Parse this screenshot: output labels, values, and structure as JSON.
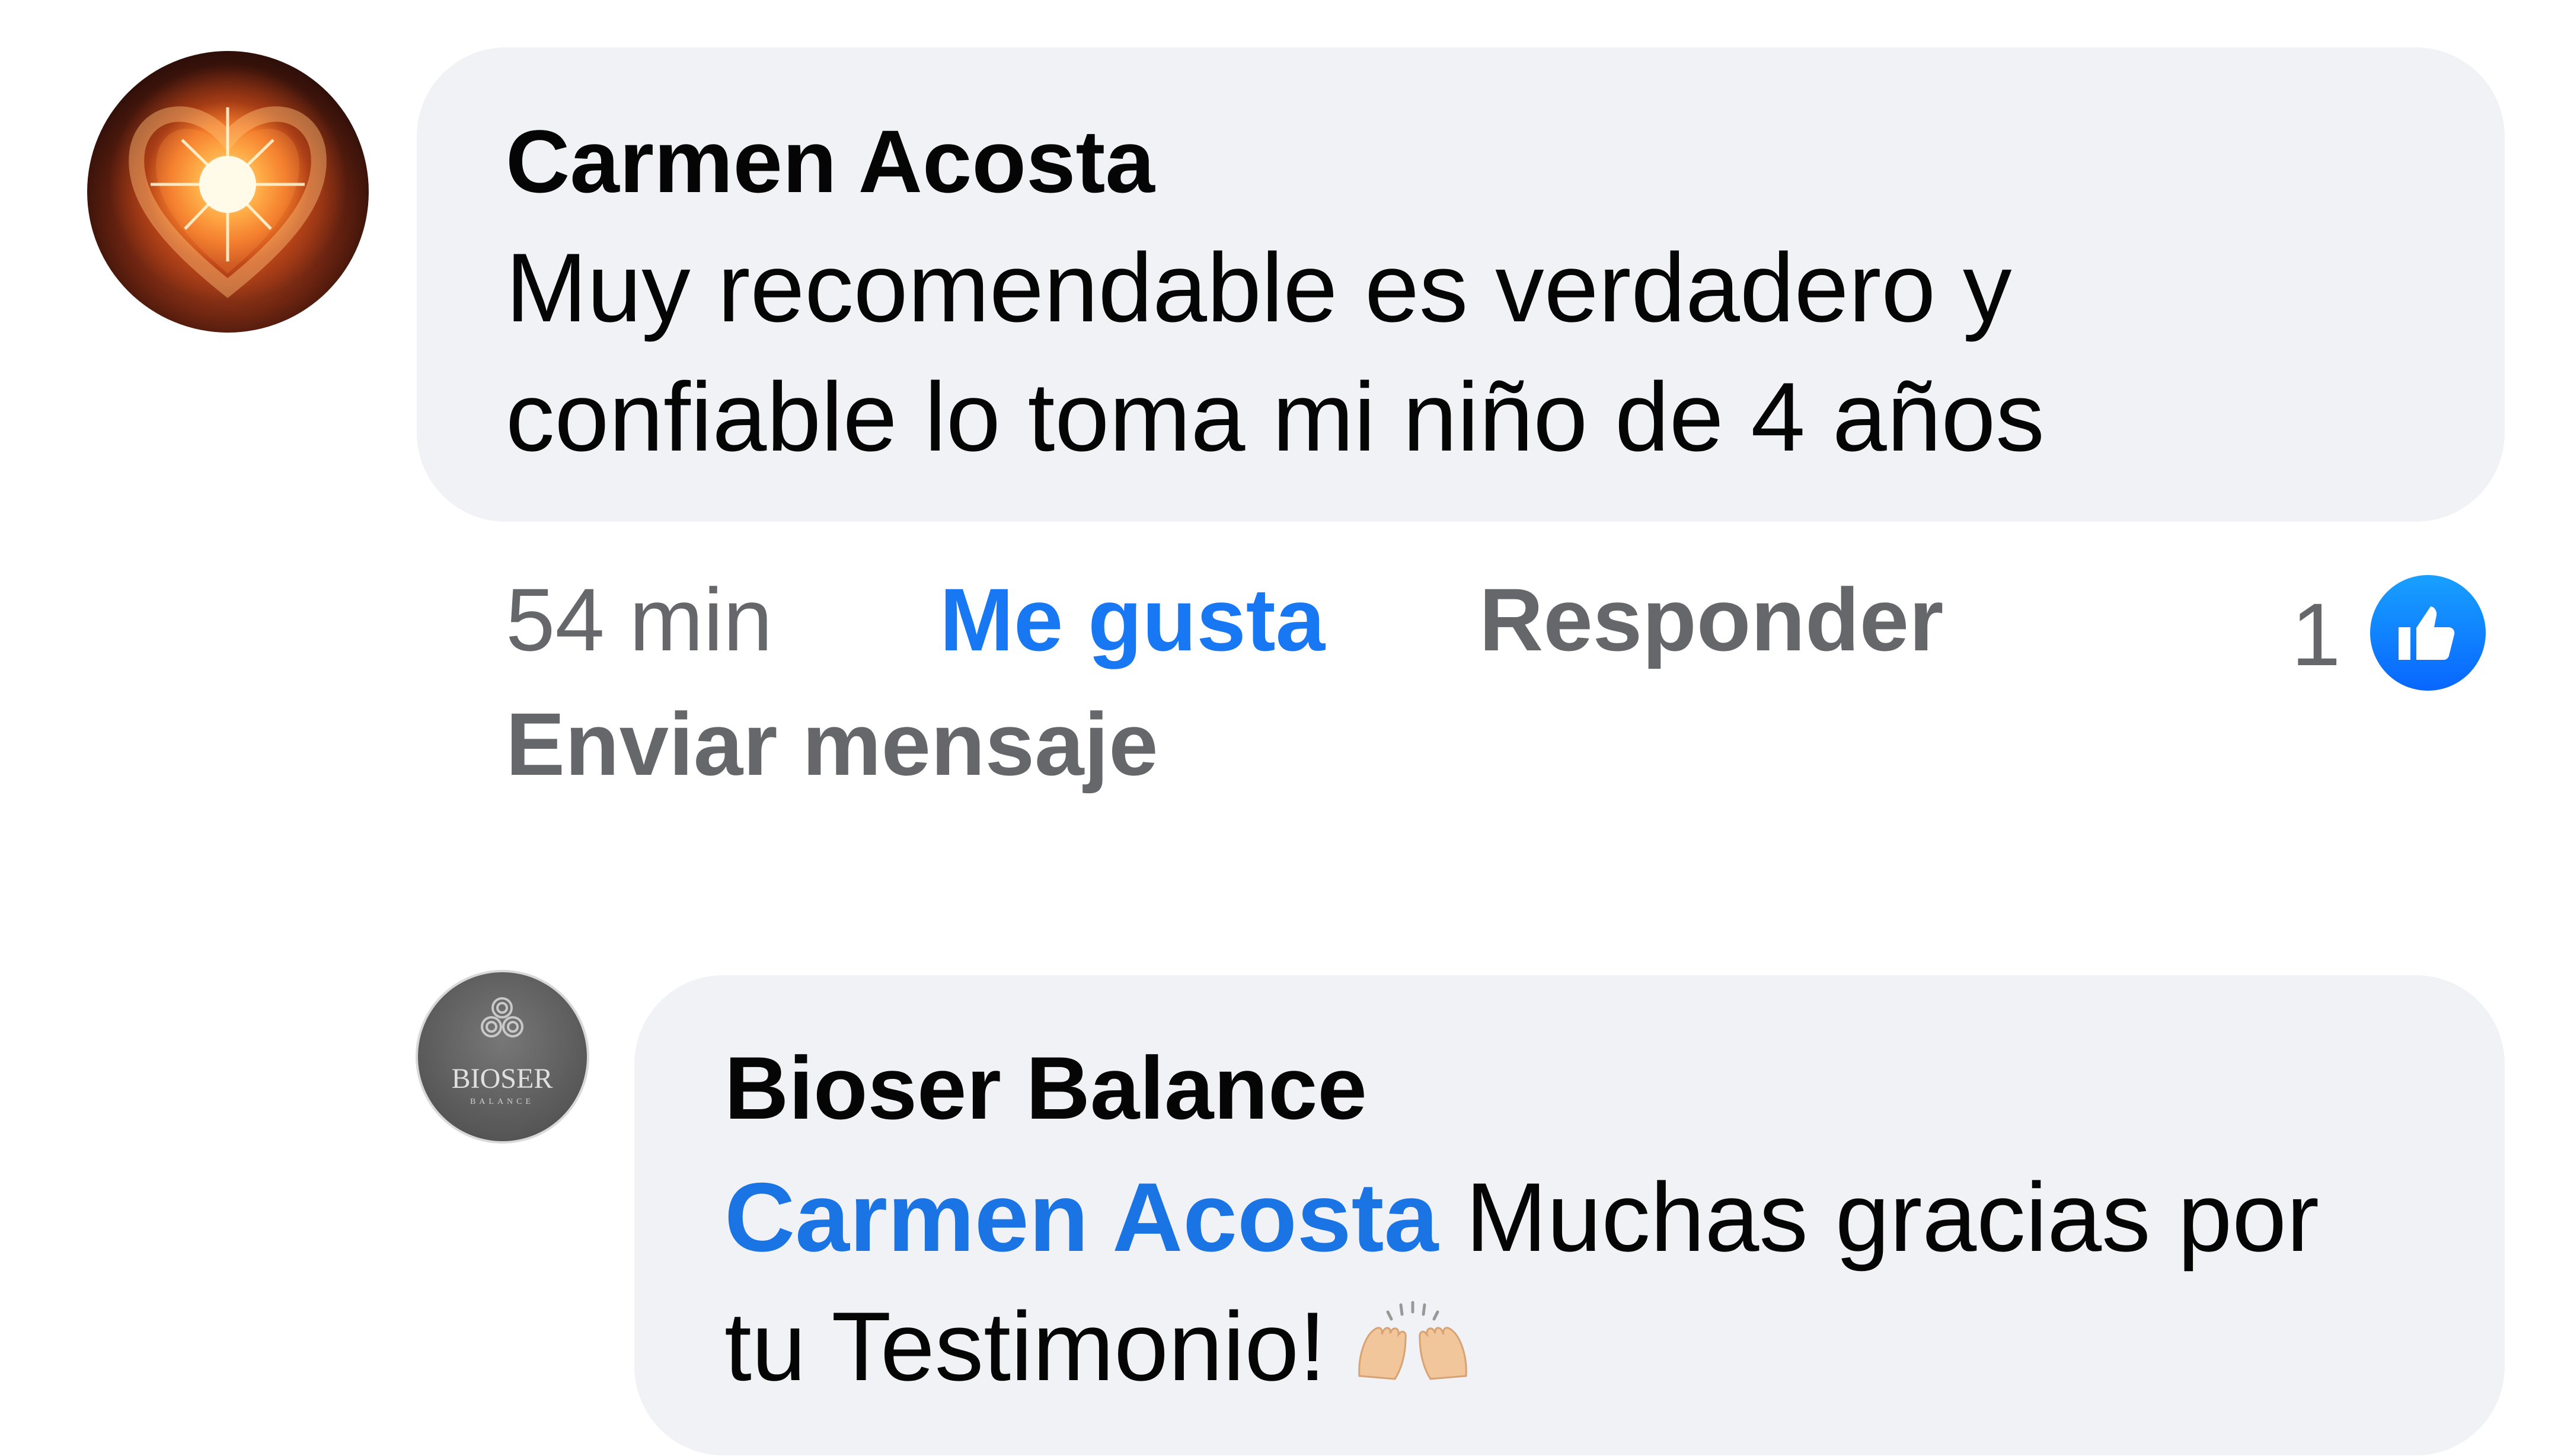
{
  "comment": {
    "author": "Carmen Acosta",
    "text_line1": "Muy recomendable es verdadero y",
    "text_line2": "confiable lo toma mi niño de 4 años",
    "time": "54 min",
    "like_action": "Me gusta",
    "reply_action": "Responder",
    "message_action": "Enviar mensaje",
    "like_count": "1",
    "avatar_icon": "heart-light-avatar"
  },
  "reply": {
    "author": "Bioser Balance",
    "mention": "Carmen Acosta",
    "text_line1": " Muchas gracias por",
    "text_line2": "tu Testimonio!",
    "emoji": "raising-hands-emoji",
    "avatar_logo_text": "BIOSER",
    "avatar_logo_subtext": "BALANCE"
  },
  "colors": {
    "bubble": "#f0f2f5",
    "link_blue": "#1877f2",
    "meta_gray": "#65676b"
  }
}
